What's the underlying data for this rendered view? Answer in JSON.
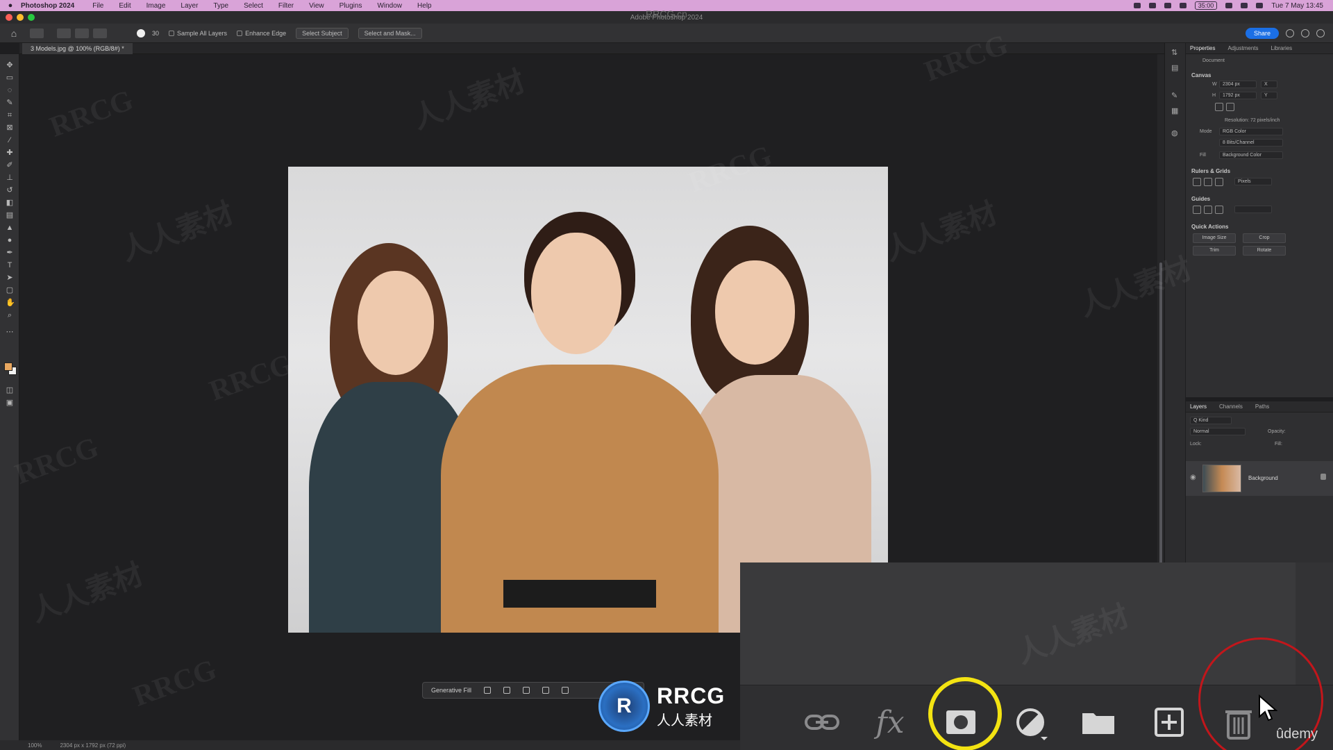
{
  "menubar": {
    "app_name": "Photoshop 2024",
    "items": [
      "File",
      "Edit",
      "Image",
      "Layer",
      "Type",
      "Select",
      "Filter",
      "View",
      "Plugins",
      "Window",
      "Help"
    ],
    "clock": "Tue 7 May 13:45",
    "battery": "35:00"
  },
  "window": {
    "title": "Adobe Photoshop 2024",
    "title_watermark": "RRCG.cn"
  },
  "options_bar": {
    "brush_size": "30",
    "sample_all_layers": "Sample All Layers",
    "enhance_edge": "Enhance Edge",
    "select_subject": "Select Subject",
    "select_and_mask": "Select and Mask...",
    "share": "Share"
  },
  "document": {
    "tab_label": "3 Models.jpg @ 100% (RGB/8#) *"
  },
  "properties": {
    "tabs": [
      "Properties",
      "Adjustments",
      "Libraries"
    ],
    "doc_label": "Document",
    "canvas_title": "Canvas",
    "width": "2304 px",
    "height": "1792 px",
    "resolution": "Resolution: 72 pixels/inch",
    "mode_label": "Mode",
    "mode_value": "RGB Color",
    "bit_depth": "8 Bits/Channel",
    "fill_label": "Fill",
    "fill_value": "Background Color",
    "rulers_title": "Rulers & Grids",
    "units": "Pixels",
    "guides_title": "Guides",
    "quick_actions_title": "Quick Actions",
    "quick_actions": [
      "Image Size",
      "Crop",
      "Trim",
      "Rotate"
    ]
  },
  "layers": {
    "tabs": [
      "Layers",
      "Channels",
      "Paths"
    ],
    "kind_label": "Q Kind",
    "blend_mode": "Normal",
    "opacity_label": "Opacity:",
    "lock_label": "Lock:",
    "fill_label": "Fill:",
    "layer_name": "Background"
  },
  "contextual_taskbar": {
    "generative_fill": "Generative Fill"
  },
  "zoomed_footer": {
    "icons": [
      "link-layers-icon",
      "fx-icon",
      "add-mask-icon",
      "adjustment-layer-icon",
      "group-folder-icon",
      "new-layer-icon",
      "delete-layer-icon"
    ],
    "fx_text": "fx"
  },
  "status_bar": {
    "zoom": "100%",
    "doc_info": "2304 px x 1792 px (72 ppi)"
  },
  "watermark": {
    "logo_mark": "R",
    "logo_text": "RRCG",
    "logo_subtext": "人人素材",
    "tiles": [
      "RRCG",
      "人人素材",
      "RRCG",
      "人人素材",
      "RRCG",
      "人人素材",
      "RRCG",
      "人人素材",
      "RRCG",
      "人人素材",
      "RRCG",
      "人人素材"
    ]
  },
  "udemy": "ûdemy",
  "colors": {
    "menubar": "#d9a3d8",
    "share_button": "#1b6fe5",
    "highlight_yellow": "#f3e312",
    "highlight_red": "#c2161b"
  }
}
